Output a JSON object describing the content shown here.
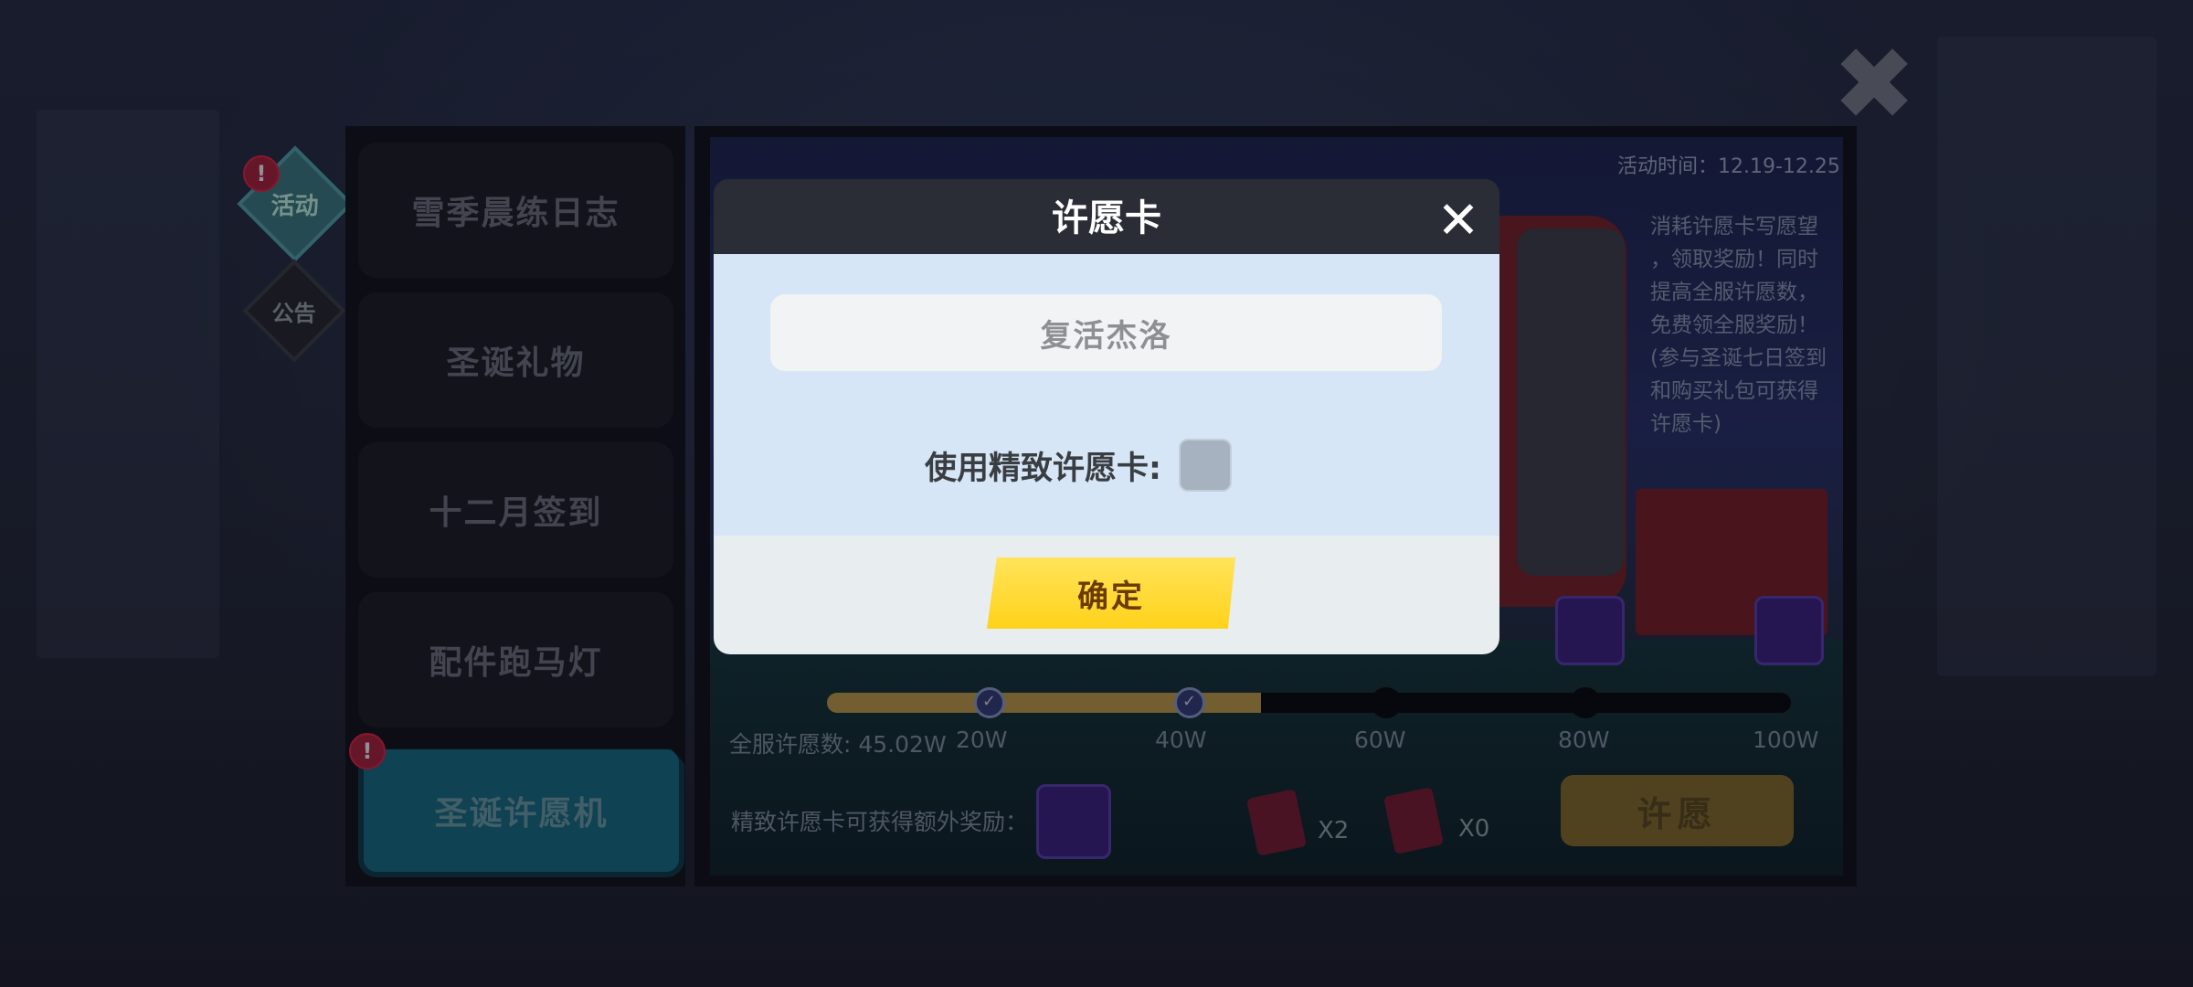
{
  "side_tabs": [
    {
      "label": "活动",
      "badge": "!"
    },
    {
      "label": "公告"
    }
  ],
  "menu": [
    {
      "label": "雪季晨练日志"
    },
    {
      "label": "圣诞礼物"
    },
    {
      "label": "十二月签到"
    },
    {
      "label": "配件跑马灯"
    },
    {
      "label": "圣诞许愿机",
      "badge": "!",
      "active": true
    }
  ],
  "event": {
    "time_label": "活动时间：12.19-12.25",
    "description_lines": [
      "消耗许愿卡写愿望",
      "，领取奖励！同时",
      "提高全服许愿数，",
      "免费领全服奖励！",
      "(参与圣诞七日签到",
      "和购买礼包可获得",
      "许愿卡)"
    ],
    "total_label": "全服许愿数: 45.02W",
    "progress_fraction": 0.45,
    "milestones": [
      "20W",
      "40W",
      "60W",
      "80W",
      "100W"
    ],
    "extra_reward_label": "精致许愿卡可获得额外奖励：",
    "normal_card_count": "X2",
    "fine_card_count": "X0",
    "wish_button": "许愿"
  },
  "dialog": {
    "title": "许愿卡",
    "name_value": "复活杰洛",
    "use_fine_card_label": "使用精致许愿卡:",
    "confirm_button": "确定"
  },
  "icons": {
    "close_main": "close-icon",
    "close_dialog": "close-icon"
  }
}
